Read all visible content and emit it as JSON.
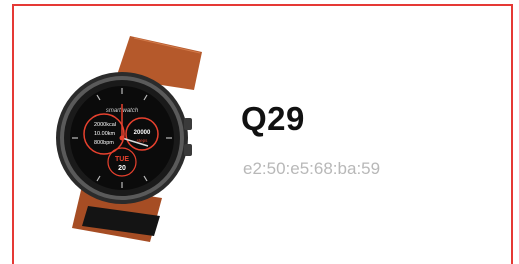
{
  "device": {
    "name": "Q29",
    "mac": "e2:50:e5:68:ba:59"
  },
  "watch_face": {
    "brand_text": "smart watch",
    "calories": "2000kcal",
    "distance": "10.00km",
    "heart_rate": "800bpm",
    "steps_value": "20000",
    "steps_label": "steps",
    "day": "TUE",
    "date": "20"
  },
  "colors": {
    "card_border": "#e53935",
    "strap": "#b5592b",
    "face_accent": "#e8412e"
  }
}
